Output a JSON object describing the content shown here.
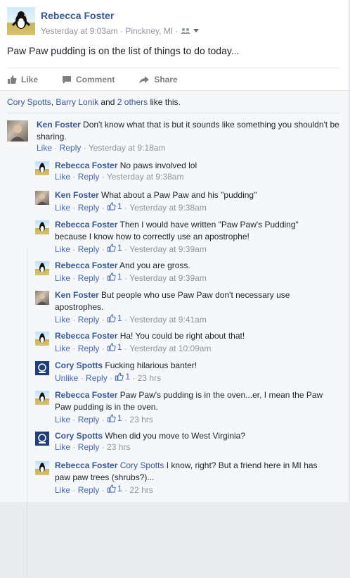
{
  "post": {
    "author": "Rebecca Foster",
    "time": "Yesterday at 9:03am",
    "location": "Pinckney, MI",
    "text": "Paw Paw pudding is on the list of things to do today...",
    "actions": {
      "like": "Like",
      "comment": "Comment",
      "share": "Share"
    }
  },
  "likes": {
    "names": [
      "Cory Spotts",
      "Barry Lonik"
    ],
    "sep": ", ",
    "and": " and ",
    "others": "2 others",
    "suffix": " like this."
  },
  "comments": [
    {
      "avatar": "ken",
      "name": "Ken Foster",
      "text": "Don't know what that is but it sounds like something you shouldn't be",
      "text2": "sharing.",
      "action": "Like",
      "reply": "Reply",
      "likes": "",
      "time": "Yesterday at 9:18am"
    },
    {
      "avatar": "penguin",
      "name": "Rebecca Foster",
      "text": "No paws involved lol",
      "action": "Like",
      "reply": "Reply",
      "likes": "",
      "time": "Yesterday at 9:38am"
    },
    {
      "avatar": "ken",
      "name": "Ken Foster",
      "text": "What about a Paw Paw and his \"pudding\"",
      "action": "Like",
      "reply": "Reply",
      "likes": "1",
      "time": "Yesterday at 9:38am"
    },
    {
      "avatar": "penguin",
      "name": "Rebecca Foster",
      "text": "Then I would have written \"Paw Paw's Pudding\"",
      "text2": "because I know how to correctly use an apostrophe!",
      "action": "Like",
      "reply": "Reply",
      "likes": "1",
      "time": "Yesterday at 9:39am"
    },
    {
      "avatar": "penguin",
      "name": "Rebecca Foster",
      "text": "And you are gross.",
      "action": "Like",
      "reply": "Reply",
      "likes": "1",
      "time": "Yesterday at 9:39am"
    },
    {
      "avatar": "ken",
      "name": "Ken Foster",
      "text": "But people who use Paw Paw don't necessary use",
      "text2": "apostrophes.",
      "action": "Like",
      "reply": "Reply",
      "likes": "1",
      "time": "Yesterday at 9:41am"
    },
    {
      "avatar": "penguin",
      "name": "Rebecca Foster",
      "text": "Ha! You could be right about that!",
      "action": "Like",
      "reply": "Reply",
      "likes": "1",
      "time": "Yesterday at 10:09am"
    },
    {
      "avatar": "cory",
      "name": "Cory Spotts",
      "text": "Fucking hilarious banter!",
      "action": "Unlike",
      "reply": "Reply",
      "likes": "1",
      "time": "23 hrs"
    },
    {
      "avatar": "penguin",
      "name": "Rebecca Foster",
      "text": "Paw Paw's pudding is in the oven...er, I mean the Paw",
      "text2": "Paw pudding is in the oven.",
      "action": "Like",
      "reply": "Reply",
      "likes": "1",
      "time": "23 hrs"
    },
    {
      "avatar": "cory",
      "name": "Cory Spotts",
      "text": "When did you move to West Virginia?",
      "action": "Like",
      "reply": "Reply",
      "likes": "",
      "time": "23 hrs"
    },
    {
      "avatar": "penguin",
      "name": "Rebecca Foster",
      "mention": "Cory Spotts",
      "text": "I know, right? But a friend here in MI has",
      "text2": "paw paw trees (shrubs?)...",
      "action": "Like",
      "reply": "Reply",
      "likes": "1",
      "time": "22 hrs"
    }
  ],
  "icons": {
    "like": "thumbs-up-icon",
    "comment": "comment-bubble-icon",
    "share": "share-arrow-icon",
    "audience": "friends-icon",
    "dropdown": "chevron-down-icon"
  },
  "colors": {
    "link": "#365899",
    "action": "#4267b2",
    "meta": "#90949c"
  }
}
